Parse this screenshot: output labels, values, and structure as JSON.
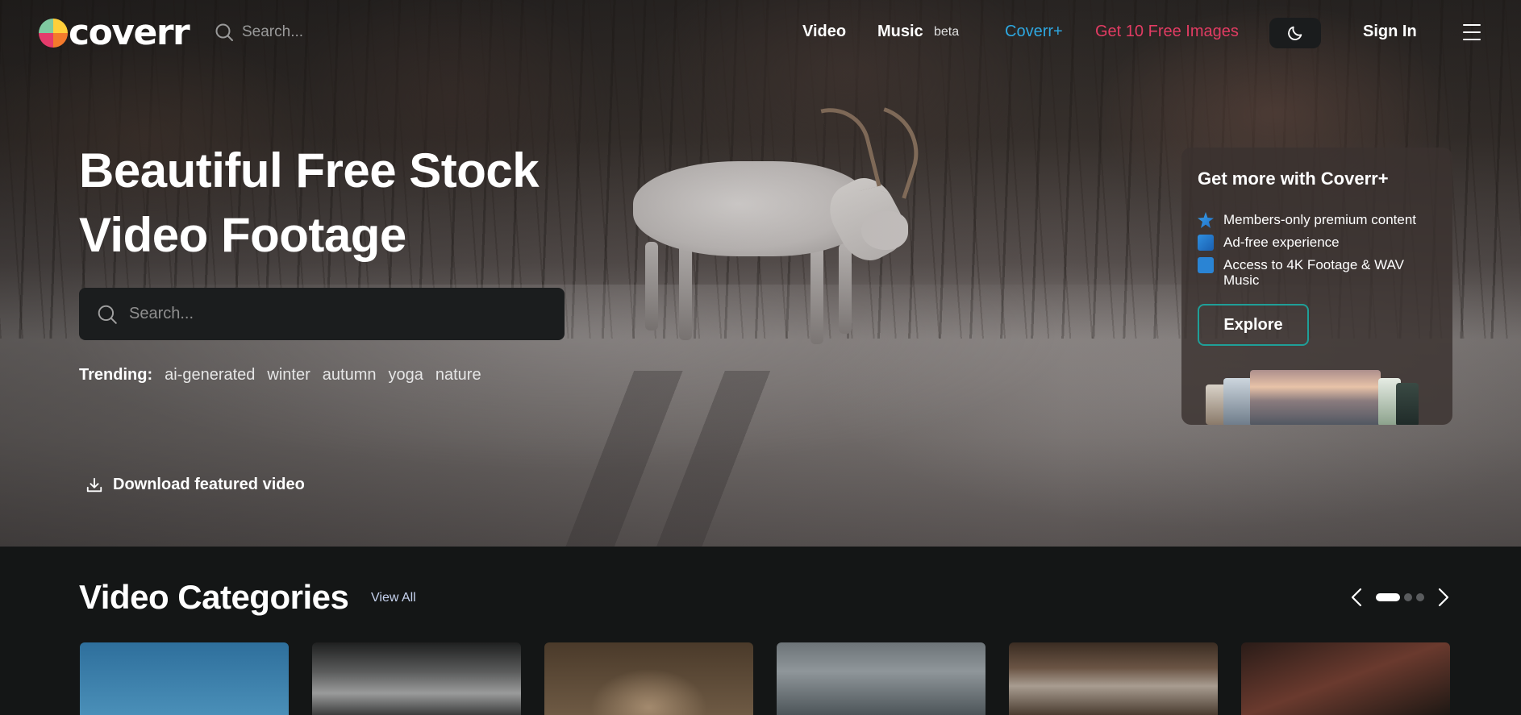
{
  "nav": {
    "logo_text": "coverr",
    "search_placeholder": "Search...",
    "video": "Video",
    "music": "Music",
    "beta": "beta",
    "coverr_plus": "Coverr+",
    "free_images": "Get 10 Free Images",
    "sign_in": "Sign In",
    "icons": [
      "search-icon",
      "moon-icon",
      "menu-icon"
    ]
  },
  "hero": {
    "title_line1": "Beautiful Free Stock",
    "title_line2": "Video Footage",
    "search_placeholder": "Search...",
    "trending_label": "Trending:",
    "trending_tags": [
      "ai-generated",
      "winter",
      "autumn",
      "yoga",
      "nature"
    ],
    "download_label": "Download featured video"
  },
  "promo": {
    "title": "Get more with Coverr+",
    "benefits": [
      "Members-only premium content",
      "Ad-free experience",
      "Access to 4K Footage & WAV Music"
    ],
    "explore_label": "Explore"
  },
  "categories": {
    "title": "Video Categories",
    "view_all": "View All",
    "carousel_pages": 3,
    "active_page": 1
  },
  "colors": {
    "accent_blue": "#2ea7e0",
    "accent_red": "#e23c63",
    "explore_border": "#1f9f98",
    "page_bg": "#141616"
  }
}
